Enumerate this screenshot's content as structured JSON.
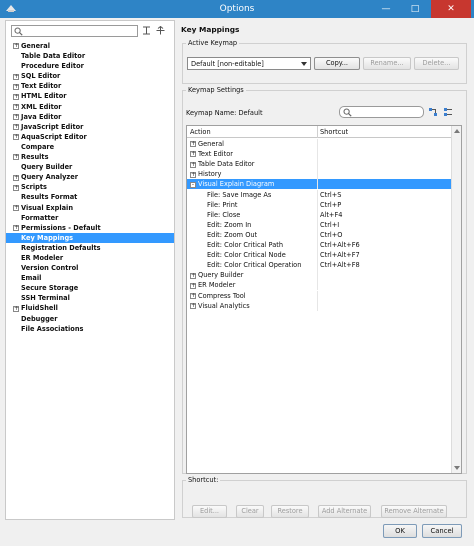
{
  "window": {
    "title": "Options"
  },
  "left": {
    "search_placeholder": "",
    "tree": [
      {
        "label": "General",
        "expandable": true
      },
      {
        "label": "Table Data Editor",
        "expandable": false
      },
      {
        "label": "Procedure Editor",
        "expandable": false
      },
      {
        "label": "SQL Editor",
        "expandable": true
      },
      {
        "label": "Text Editor",
        "expandable": true
      },
      {
        "label": "HTML Editor",
        "expandable": true
      },
      {
        "label": "XML Editor",
        "expandable": true
      },
      {
        "label": "Java Editor",
        "expandable": true
      },
      {
        "label": "JavaScript Editor",
        "expandable": true
      },
      {
        "label": "AquaScript Editor",
        "expandable": true
      },
      {
        "label": "Compare",
        "expandable": false
      },
      {
        "label": "Results",
        "expandable": true
      },
      {
        "label": "Query Builder",
        "expandable": false
      },
      {
        "label": "Query Analyzer",
        "expandable": true
      },
      {
        "label": "Scripts",
        "expandable": true
      },
      {
        "label": "Results Format",
        "expandable": false
      },
      {
        "label": "Visual Explain",
        "expandable": true
      },
      {
        "label": "Formatter",
        "expandable": false
      },
      {
        "label": "Permissions - Default",
        "expandable": true
      },
      {
        "label": "Key Mappings",
        "expandable": false,
        "selected": true
      },
      {
        "label": "Registration Defaults",
        "expandable": false
      },
      {
        "label": "ER Modeler",
        "expandable": false
      },
      {
        "label": "Version Control",
        "expandable": false
      },
      {
        "label": "Email",
        "expandable": false
      },
      {
        "label": "Secure Storage",
        "expandable": false
      },
      {
        "label": "SSH Terminal",
        "expandable": false
      },
      {
        "label": "FluidShell",
        "expandable": true
      },
      {
        "label": "Debugger",
        "expandable": false
      },
      {
        "label": "File Associations",
        "expandable": false
      }
    ]
  },
  "right": {
    "title": "Key Mappings",
    "active_keymap": {
      "legend": "Active Keymap",
      "selected": "Default [non-editable]",
      "copy_label": "Copy...",
      "rename_label": "Rename...",
      "delete_label": "Delete..."
    },
    "keymap_settings": {
      "legend": "Keymap Settings",
      "keymap_name": "Keymap Name: Default",
      "search_placeholder": "",
      "columns": [
        "Action",
        "Shortcut"
      ],
      "rows": [
        {
          "action": "General",
          "shortcut": "",
          "level": 0,
          "expander": "+"
        },
        {
          "action": "Text Editor",
          "shortcut": "",
          "level": 0,
          "expander": "+"
        },
        {
          "action": "Table Data Editor",
          "shortcut": "",
          "level": 0,
          "expander": "+"
        },
        {
          "action": "History",
          "shortcut": "",
          "level": 0,
          "expander": "+"
        },
        {
          "action": "Visual Explain Diagram",
          "shortcut": "",
          "level": 0,
          "expander": "-",
          "selected": true
        },
        {
          "action": "File: Save Image As",
          "shortcut": "Ctrl+S",
          "level": 1
        },
        {
          "action": "File: Print",
          "shortcut": "Ctrl+P",
          "level": 1
        },
        {
          "action": "File: Close",
          "shortcut": "Alt+F4",
          "level": 1
        },
        {
          "action": "Edit: Zoom In",
          "shortcut": "Ctrl+I",
          "level": 1
        },
        {
          "action": "Edit: Zoom Out",
          "shortcut": "Ctrl+O",
          "level": 1
        },
        {
          "action": "Edit: Color Critical Path",
          "shortcut": "Ctrl+Alt+F6",
          "level": 1
        },
        {
          "action": "Edit: Color Critical Node",
          "shortcut": "Ctrl+Alt+F7",
          "level": 1
        },
        {
          "action": "Edit: Color Critical Operation",
          "shortcut": "Ctrl+Alt+F8",
          "level": 1
        },
        {
          "action": "Query Builder",
          "shortcut": "",
          "level": 0,
          "expander": "+"
        },
        {
          "action": "ER Modeler",
          "shortcut": "",
          "level": 0,
          "expander": "+"
        },
        {
          "action": "Compress Tool",
          "shortcut": "",
          "level": 0,
          "expander": "+"
        },
        {
          "action": "Visual Analytics",
          "shortcut": "",
          "level": 0,
          "expander": "+"
        }
      ]
    },
    "shortcut": {
      "legend": "Shortcut:",
      "edit_label": "Edit...",
      "clear_label": "Clear",
      "restore_label": "Restore",
      "add_alternate_label": "Add Alternate",
      "remove_alternate_label": "Remove Alternate"
    }
  },
  "footer": {
    "ok_label": "OK",
    "cancel_label": "Cancel"
  },
  "colors": {
    "titlebar": "#2e84c6",
    "selection": "#3399ff",
    "close": "#c7372f"
  },
  "icons": [
    "window-app-icon",
    "search-icon",
    "expand-all-icon",
    "collapse-all-icon"
  ]
}
